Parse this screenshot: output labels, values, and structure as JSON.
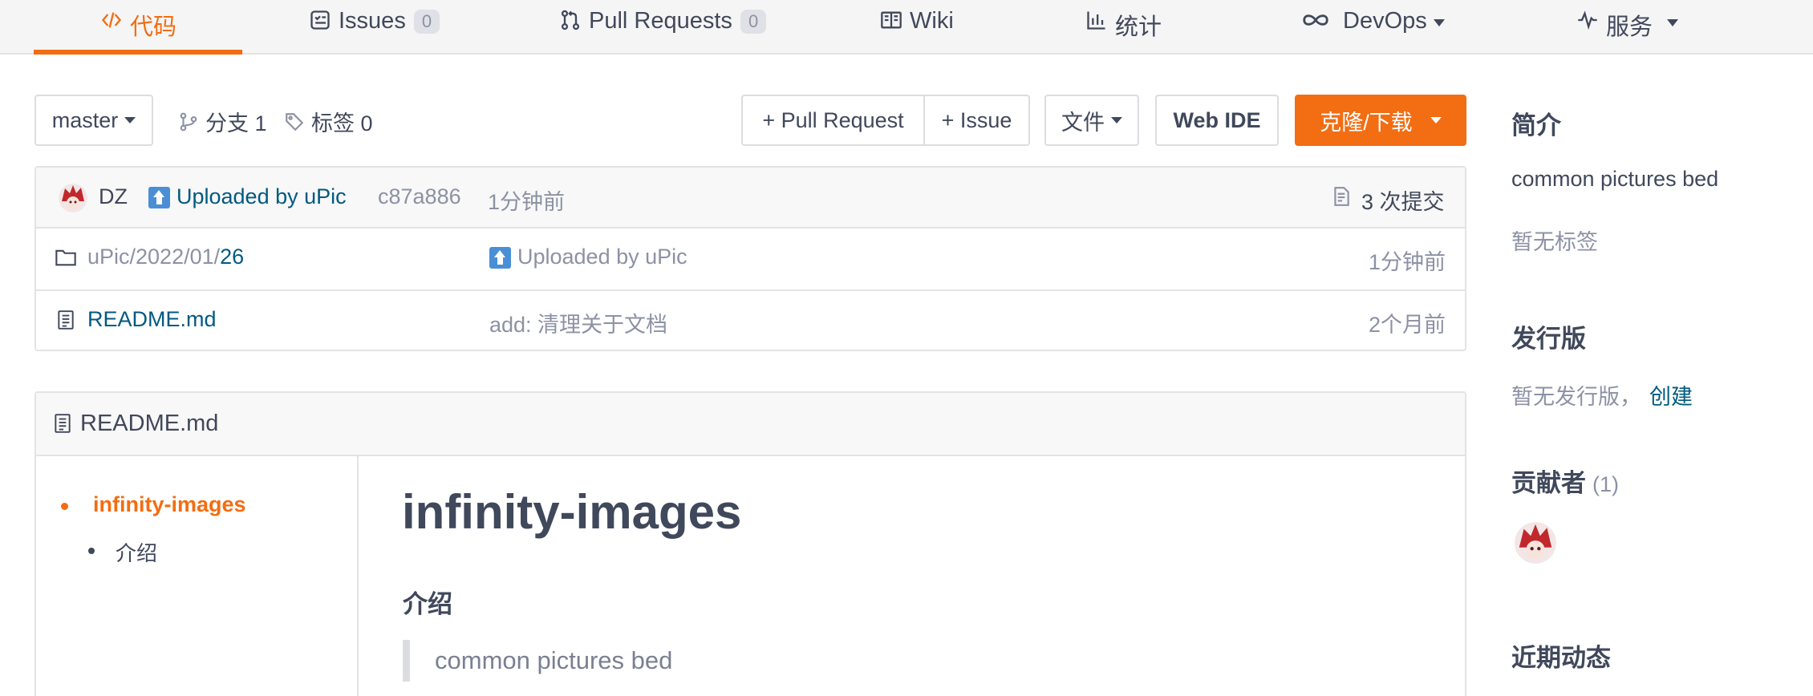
{
  "tabs": [
    {
      "label": "代码",
      "icon": "code-icon",
      "active": true
    },
    {
      "label": "Issues",
      "icon": "issues-icon",
      "count": "0"
    },
    {
      "label": "Pull Requests",
      "icon": "pull-request-icon",
      "count": "0"
    },
    {
      "label": "Wiki",
      "icon": "wiki-icon"
    },
    {
      "label": "统计",
      "icon": "stats-icon"
    },
    {
      "label": "DevOps",
      "icon": "infinity-icon",
      "dropdown": true
    },
    {
      "label": "服务",
      "icon": "pulse-icon",
      "dropdown": true
    }
  ],
  "toolbar": {
    "branch_select": "master",
    "branches": "分支 1",
    "tags": "标签 0",
    "pull_request": "+ Pull Request",
    "issue": "+ Issue",
    "file": "文件",
    "web_ide": "Web IDE",
    "clone": "克隆/下载"
  },
  "commit": {
    "author": "DZ",
    "message": "Uploaded by uPic",
    "hash": "c87a886",
    "time": "1分钟前",
    "commits": "3 次提交"
  },
  "files": [
    {
      "name_prefix": "uPic/2022/01/",
      "name_last": "26",
      "icon": "folder-icon",
      "message": "Uploaded by uPic",
      "message_icon": "upload-icon",
      "time": "1分钟前"
    },
    {
      "name_prefix": "",
      "name_last": "README.md",
      "icon": "file-icon",
      "message": "add: 清理关于文档",
      "time": "2个月前"
    }
  ],
  "readme": {
    "filename": "README.md",
    "toc": [
      {
        "label": "infinity-images",
        "level": 1,
        "active": true
      },
      {
        "label": "介绍",
        "level": 2
      }
    ],
    "title": "infinity-images",
    "section": "介绍",
    "quote": "common pictures bed"
  },
  "sidebar": {
    "intro_heading": "简介",
    "description": "common pictures bed",
    "no_tags": "暂无标签",
    "release_heading": "发行版",
    "no_release": "暂无发行版，",
    "create_link": "创建",
    "contributors_heading": "贡献者",
    "contributors_count": "(1)",
    "activity_heading": "近期动态"
  },
  "colors": {
    "accent": "#f36d12",
    "link": "#005980",
    "muted": "#8c92a4",
    "text": "#40485b"
  }
}
